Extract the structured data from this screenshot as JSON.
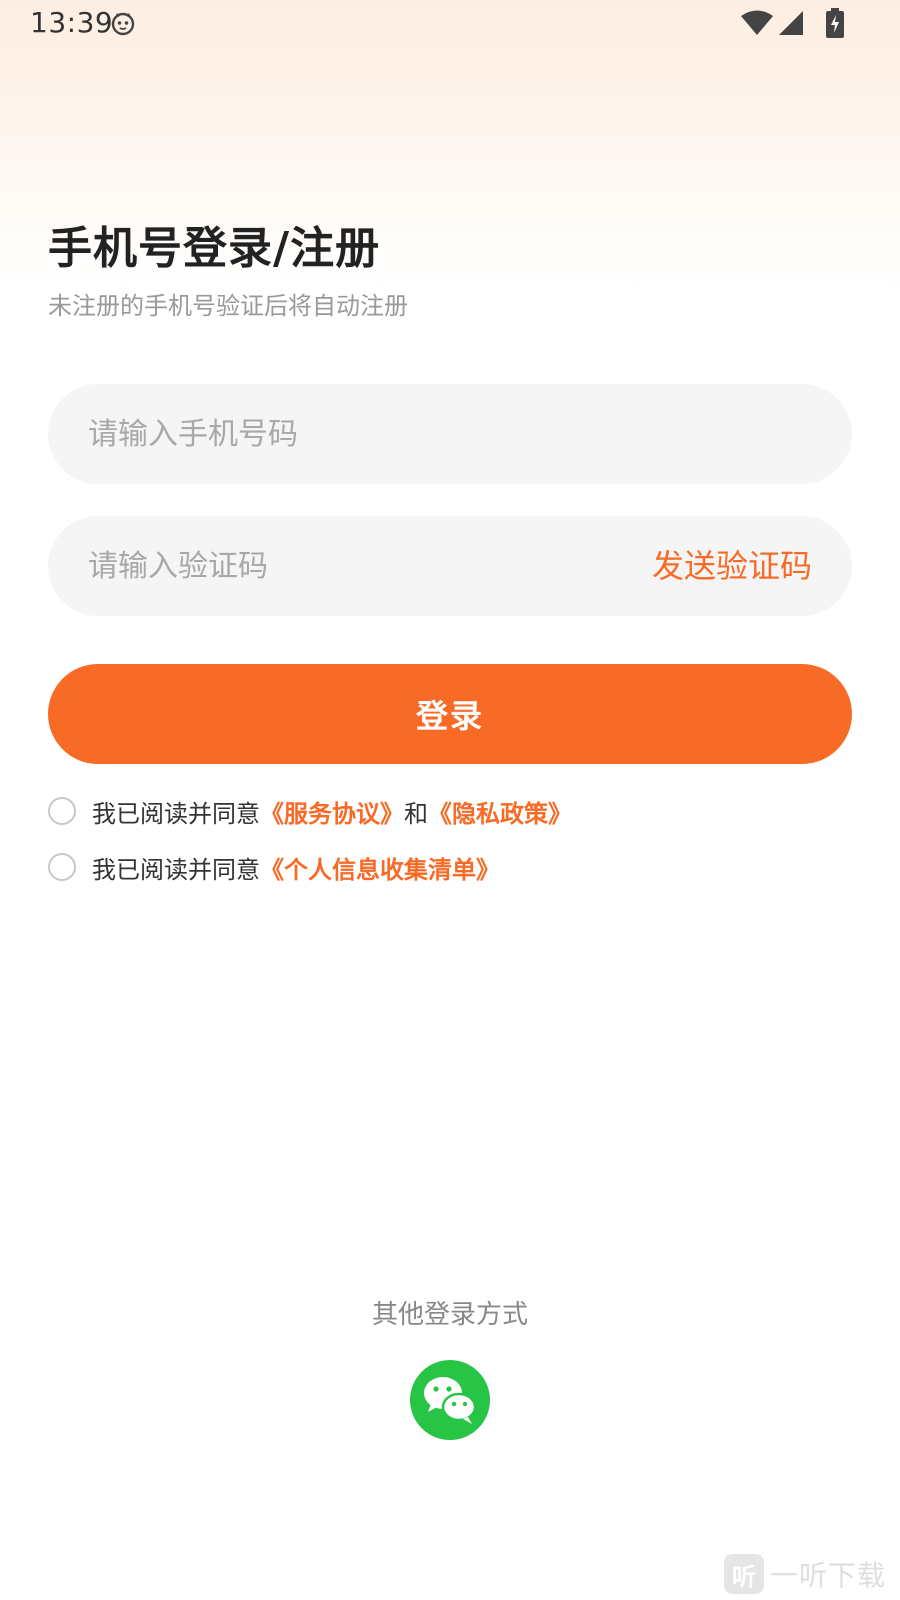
{
  "status_bar": {
    "time": "13:39",
    "icons": [
      "cat-face-icon",
      "wifi-icon",
      "cell-signal-icon",
      "battery-charging-icon"
    ]
  },
  "header": {
    "title": "手机号登录/注册",
    "subtitle": "未注册的手机号验证后将自动注册"
  },
  "form": {
    "phone_placeholder": "请输入手机号码",
    "phone_value": "",
    "code_placeholder": "请输入验证码",
    "code_value": "",
    "send_code_label": "发送验证码",
    "login_label": "登录"
  },
  "agreements": [
    {
      "prefix": "我已阅读并同意",
      "link1": "《服务协议》",
      "joiner": "和",
      "link2": "《隐私政策》",
      "checked": false
    },
    {
      "prefix": "我已阅读并同意",
      "link1": "《个人信息收集清单》",
      "checked": false
    }
  ],
  "other_login": {
    "label": "其他登录方式",
    "methods": [
      "wechat-icon"
    ]
  },
  "watermark": {
    "logo_char": "听",
    "text": "一听下载"
  },
  "colors": {
    "accent": "#f76b27",
    "wechat_green": "#28c445"
  }
}
